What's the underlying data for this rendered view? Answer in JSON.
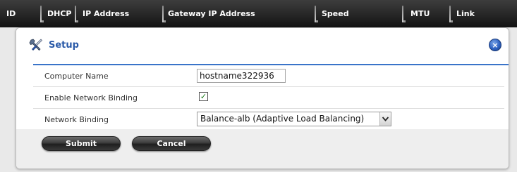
{
  "table_header": {
    "columns": [
      "ID",
      "DHCP",
      "IP Address",
      "Gateway IP Address",
      "Speed",
      "MTU",
      "Link"
    ]
  },
  "dialog": {
    "title": "Setup",
    "title_icon": "tools-icon",
    "close_icon": "close-icon",
    "close_glyph": "×",
    "fields": {
      "computer_name_label": "Computer Name",
      "computer_name_value": "hostname322936",
      "enable_binding_label": "Enable Network Binding",
      "enable_binding_checked": true,
      "check_glyph": "✓",
      "binding_label": "Network Binding",
      "binding_selected": "Balance-alb (Adaptive Load Balancing)"
    },
    "buttons": {
      "submit": "Submit",
      "cancel": "Cancel"
    }
  },
  "colors": {
    "title_blue": "#2a5aa8",
    "rule_blue": "#3a74c9",
    "header_dark": "#262626",
    "check_green": "#1a7a1a"
  }
}
